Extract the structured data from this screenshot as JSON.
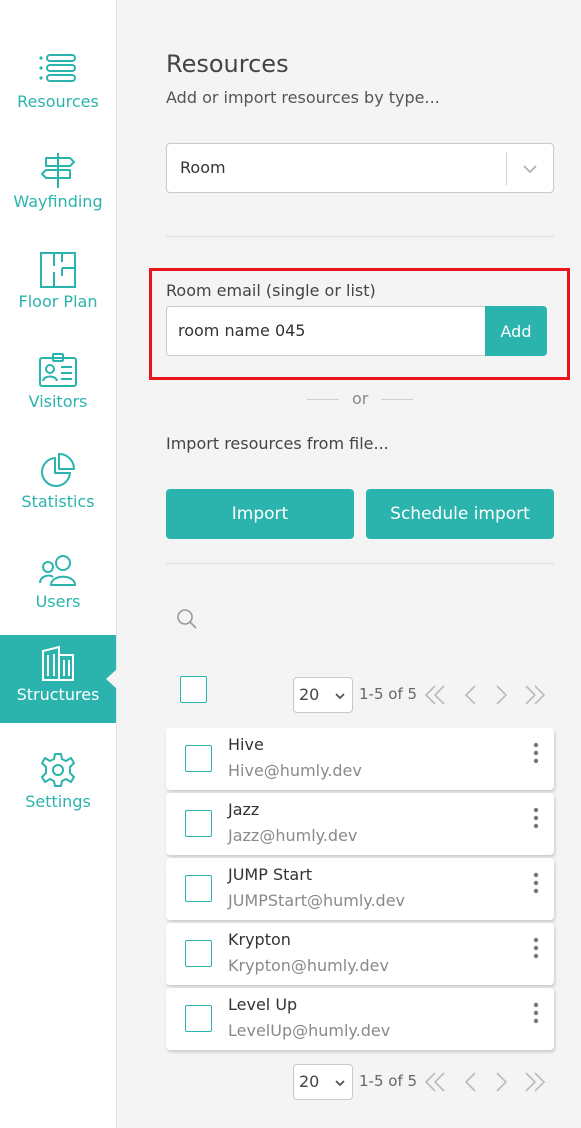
{
  "sidebar": {
    "items": [
      {
        "label": "Resources",
        "icon": "list-icon",
        "active": false
      },
      {
        "label": "Wayfinding",
        "icon": "signpost-icon",
        "active": false
      },
      {
        "label": "Floor Plan",
        "icon": "floor-plan-icon",
        "active": false
      },
      {
        "label": "Visitors",
        "icon": "id-badge-icon",
        "active": false
      },
      {
        "label": "Statistics",
        "icon": "pie-chart-icon",
        "active": false
      },
      {
        "label": "Users",
        "icon": "users-icon",
        "active": false
      },
      {
        "label": "Structures",
        "icon": "building-icon",
        "active": true
      },
      {
        "label": "Settings",
        "icon": "gear-icon",
        "active": false
      }
    ]
  },
  "header": {
    "title": "Resources",
    "subtitle": "Add or import resources by type..."
  },
  "type_select": {
    "value": "Room"
  },
  "room_email": {
    "label": "Room email (single or list)",
    "value": "room name 045",
    "add_label": "Add"
  },
  "or_text": "or",
  "import_section": {
    "label": "Import resources from file...",
    "import_label": "Import",
    "schedule_label": "Schedule import"
  },
  "pagination": {
    "page_size": "20",
    "range_text": "1-5 of 5"
  },
  "resources": [
    {
      "name": "Hive",
      "email": "Hive@humly.dev"
    },
    {
      "name": "Jazz",
      "email": "Jazz@humly.dev"
    },
    {
      "name": "JUMP Start",
      "email": "JUMPStart@humly.dev"
    },
    {
      "name": "Krypton",
      "email": "Krypton@humly.dev"
    },
    {
      "name": "Level Up",
      "email": "LevelUp@humly.dev"
    }
  ],
  "colors": {
    "accent": "#2bb3ad",
    "highlight": "#e8141c",
    "background": "#f4f4f4"
  }
}
